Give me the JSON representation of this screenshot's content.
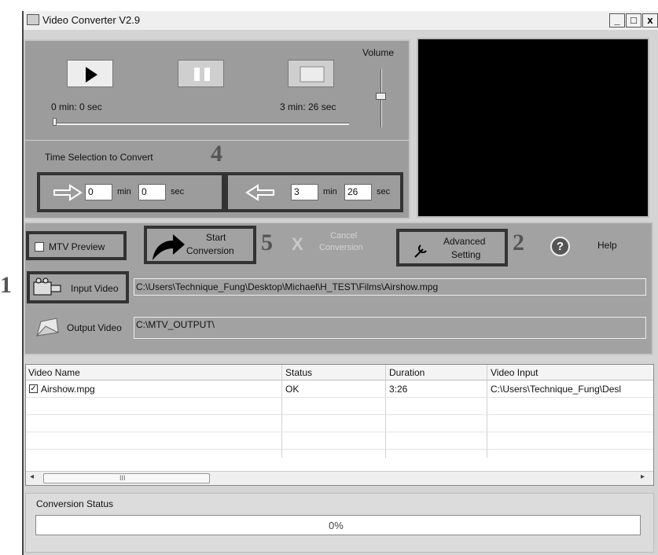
{
  "window": {
    "title": "Video Converter V2.9",
    "minimize": "_",
    "maximize": "□",
    "close": "x"
  },
  "player": {
    "play_icon": "play-icon",
    "pause_icon": "pause-icon",
    "stop_icon": "stop-icon",
    "current_time": "0 min: 0 sec",
    "total_time": "3 min: 26 sec",
    "volume_label": "Volume",
    "position_fraction": 0
  },
  "time_selection": {
    "label": "Time Selection to Convert",
    "start_min": "0",
    "start_sec": "0",
    "end_min": "3",
    "end_sec": "26",
    "min_label": "min",
    "sec_label": "sec"
  },
  "toolbar": {
    "mtv_preview_label": "MTV Preview",
    "mtv_preview_checked": false,
    "start_label_1": "Start",
    "start_label_2": "Conversion",
    "cancel_label_1": "Cancel",
    "cancel_label_2": "Conversion",
    "advanced_label_1": "Advanced",
    "advanced_label_2": "Setting",
    "help_label": "Help"
  },
  "paths": {
    "input_label": "Input Video",
    "input_value": "C:\\Users\\Technique_Fung\\Desktop\\Michael\\H_TEST\\Films\\Airshow.mpg",
    "output_label": "Output Video",
    "output_value": "C:\\MTV_OUTPUT\\"
  },
  "table": {
    "columns": [
      "Video Name",
      "Status",
      "Duration",
      "Video Input"
    ],
    "rows": [
      {
        "checked": true,
        "name": "Airshow.mpg",
        "status": "OK",
        "duration": "3:26",
        "input": "C:\\Users\\Technique_Fung\\Desl"
      }
    ],
    "scroll_grip": "III"
  },
  "status": {
    "label": "Conversion Status",
    "progress_text": "0%",
    "progress_fraction": 0
  },
  "annotations": {
    "n1": "1",
    "n2": "2",
    "n4": "4",
    "n5": "5"
  }
}
